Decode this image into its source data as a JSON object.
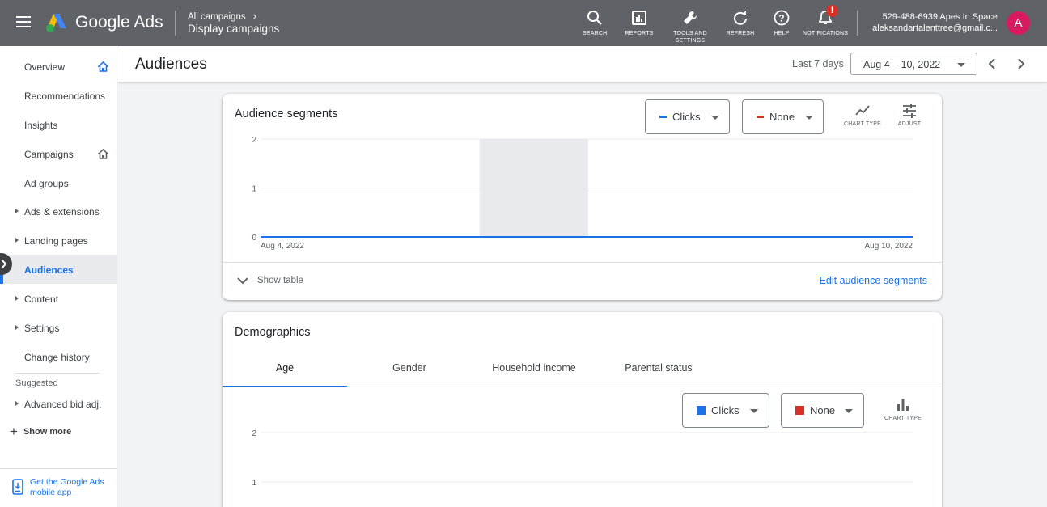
{
  "topbar": {
    "brand": "Google Ads",
    "breadcrumb_parent": "All campaigns",
    "breadcrumb_current": "Display campaigns",
    "tools": [
      {
        "label": "SEARCH",
        "icon": "search-icon"
      },
      {
        "label": "REPORTS",
        "icon": "reports-icon"
      },
      {
        "label_line1": "TOOLS AND",
        "label_line2": "SETTINGS",
        "icon": "wrench-icon"
      },
      {
        "label": "REFRESH",
        "icon": "refresh-icon"
      },
      {
        "label": "HELP",
        "icon": "help-icon"
      },
      {
        "label": "NOTIFICATIONS",
        "icon": "bell-icon",
        "badge": "!"
      }
    ],
    "account_name": "529-488-6939 Apes In Space",
    "account_email": "aleksandartalenttree@gmail.c...",
    "avatar_letter": "A"
  },
  "sidebar": {
    "items": [
      {
        "label": "Overview"
      },
      {
        "label": "Recommendations"
      },
      {
        "label": "Insights"
      },
      {
        "label": "Campaigns"
      },
      {
        "label": "Ad groups"
      },
      {
        "label": "Ads & extensions"
      },
      {
        "label": "Landing pages"
      },
      {
        "label": "Audiences"
      },
      {
        "label": "Content"
      },
      {
        "label": "Settings"
      },
      {
        "label": "Change history"
      }
    ],
    "suggested_label": "Suggested",
    "suggested_item": "Advanced bid adj.",
    "show_more": "Show more",
    "mobile_app": "Get the Google Ads mobile app"
  },
  "header": {
    "title": "Audiences",
    "range_label": "Last 7 days",
    "date_range": "Aug 4 – 10, 2022"
  },
  "audience_segments": {
    "title": "Audience segments",
    "metric1": "Clicks",
    "metric2": "None",
    "chart_type_label": "CHART TYPE",
    "adjust_label": "ADJUST",
    "show_table": "Show table",
    "edit_link": "Edit audience segments"
  },
  "demographics": {
    "title": "Demographics",
    "tabs": [
      "Age",
      "Gender",
      "Household income",
      "Parental status"
    ],
    "metric1": "Clicks",
    "metric2": "None",
    "chart_type_label": "CHART TYPE"
  },
  "colors": {
    "accent": "#1a73e8",
    "metric_none": "#d93025",
    "topbar": "#5f6368",
    "avatar": "#d81b60"
  },
  "chart_data": [
    {
      "type": "line",
      "x": [
        "Aug 4, 2022",
        "Aug 5, 2022",
        "Aug 6, 2022",
        "Aug 7, 2022",
        "Aug 8, 2022",
        "Aug 9, 2022",
        "Aug 10, 2022"
      ],
      "x_tick_labels": [
        "Aug 4, 2022",
        "Aug 10, 2022"
      ],
      "series": [
        {
          "name": "Clicks",
          "values": [
            0,
            0,
            0,
            0,
            0,
            0,
            0
          ]
        }
      ],
      "yticks": [
        "2",
        "1",
        "0"
      ],
      "ylim": [
        0,
        2
      ],
      "highlight_band": [
        "Aug 6, 2022",
        "Aug 7, 2022"
      ],
      "grid": true
    },
    {
      "type": "bar",
      "yticks": [
        "2",
        "1"
      ],
      "ylim": [
        0,
        2
      ],
      "grid": true
    }
  ]
}
